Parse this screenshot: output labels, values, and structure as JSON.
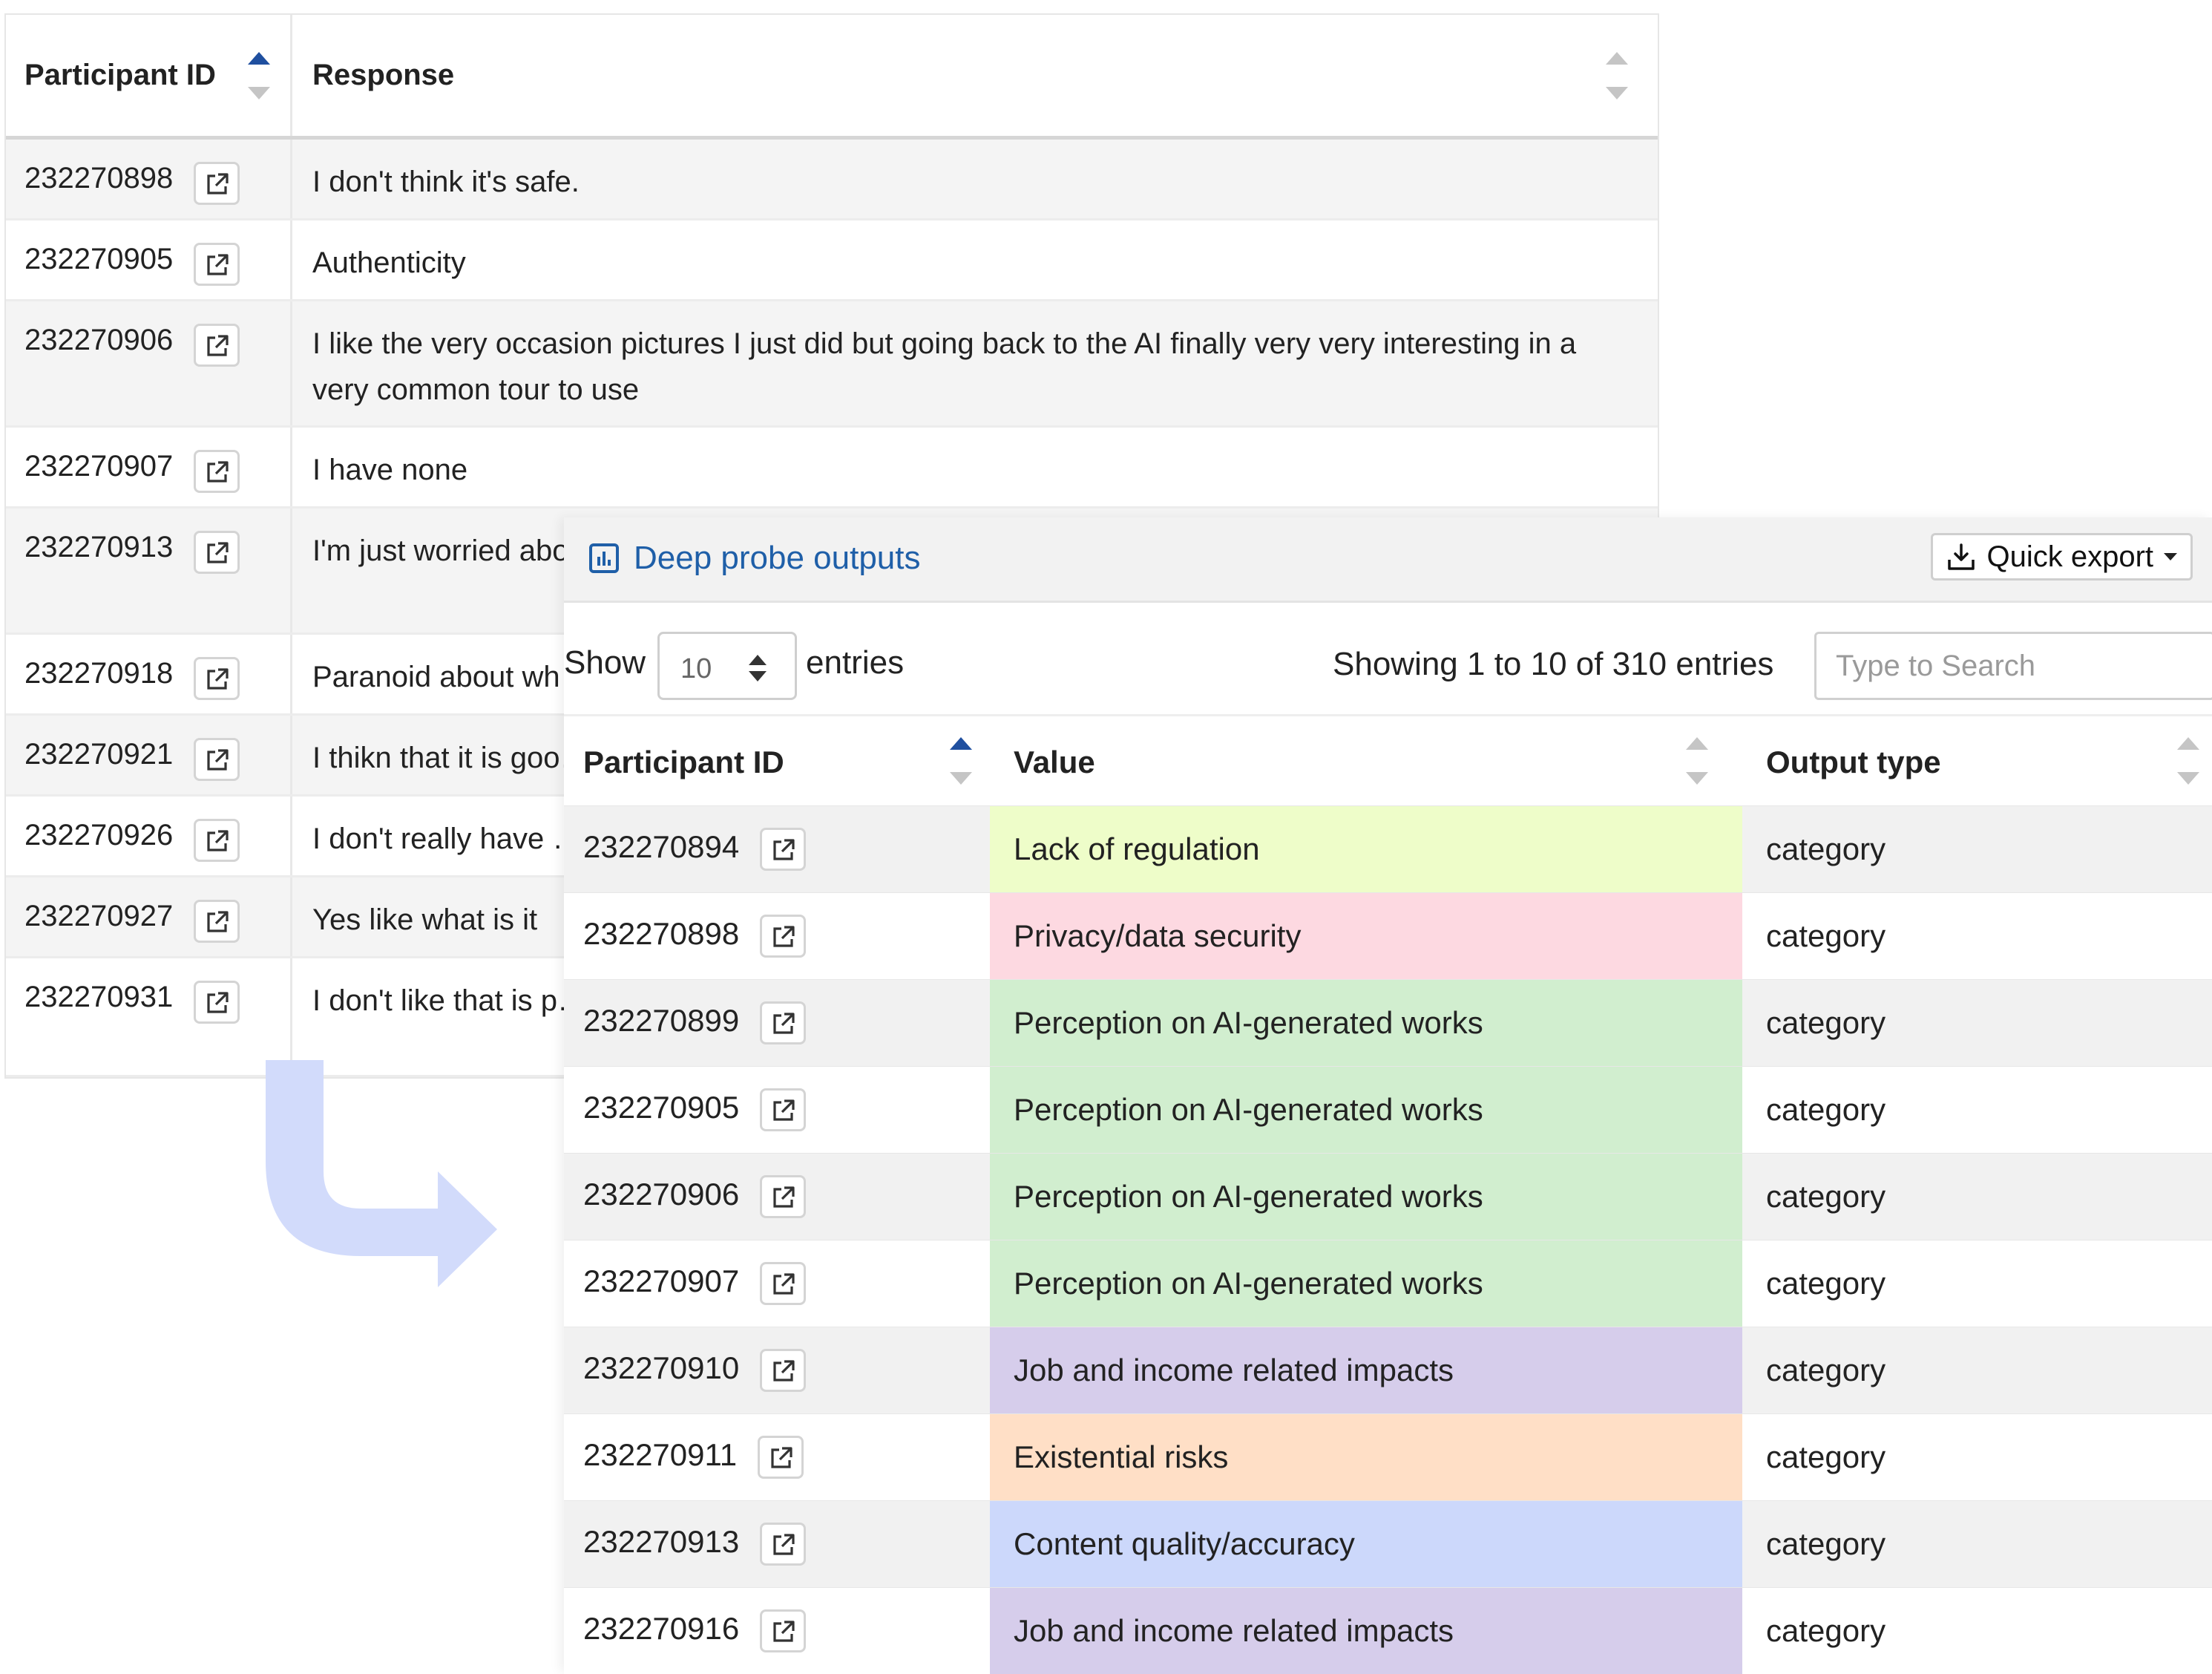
{
  "responses_table": {
    "headers": {
      "participant_id": "Participant ID",
      "response": "Response"
    },
    "rows": [
      {
        "id": "232270898",
        "response": "I don't think it's safe."
      },
      {
        "id": "232270905",
        "response": "Authenticity"
      },
      {
        "id": "232270906",
        "response": "I like the very occasion pictures I just did but going back to the AI finally very very interesting in a very common tour to use"
      },
      {
        "id": "232270907",
        "response": "I have none"
      },
      {
        "id": "232270913",
        "response": "I'm just worried abo… contact with real pe…"
      },
      {
        "id": "232270918",
        "response": "Paranoid about wh…"
      },
      {
        "id": "232270921",
        "response": "I thikn that it is goo…"
      },
      {
        "id": "232270926",
        "response": "I don't really have …"
      },
      {
        "id": "232270927",
        "response": "Yes like what is it"
      },
      {
        "id": "232270931",
        "response": "I don't like that is p… that it can cause m…"
      }
    ]
  },
  "deep_probe": {
    "title": "Deep probe outputs",
    "quick_export_label": "Quick export",
    "show_label": "Show",
    "entries_per_page": "10",
    "entries_label": "entries",
    "info": "Showing 1 to 10 of 310 entries",
    "search_placeholder": "Type to Search",
    "headers": {
      "participant_id": "Participant ID",
      "value": "Value",
      "output_type": "Output type"
    },
    "rows": [
      {
        "id": "232270894",
        "value": "Lack of regulation",
        "type": "category",
        "color": "#eefdc9"
      },
      {
        "id": "232270898",
        "value": "Privacy/data security",
        "type": "category",
        "color": "#fdd9e1"
      },
      {
        "id": "232270899",
        "value": "Perception on AI-generated works",
        "type": "category",
        "color": "#d1eecf"
      },
      {
        "id": "232270905",
        "value": "Perception on AI-generated works",
        "type": "category",
        "color": "#d1eecf"
      },
      {
        "id": "232270906",
        "value": "Perception on AI-generated works",
        "type": "category",
        "color": "#d1eecf"
      },
      {
        "id": "232270907",
        "value": "Perception on AI-generated works",
        "type": "category",
        "color": "#d1eecf"
      },
      {
        "id": "232270910",
        "value": "Job and income related impacts",
        "type": "category",
        "color": "#d6cdeb"
      },
      {
        "id": "232270911",
        "value": "Existential risks",
        "type": "category",
        "color": "#ffdfc6"
      },
      {
        "id": "232270913",
        "value": "Content quality/accuracy",
        "type": "category",
        "color": "#ccd8fb"
      },
      {
        "id": "232270916",
        "value": "Job and income related impacts",
        "type": "category",
        "color": "#d6cdeb"
      }
    ]
  },
  "colors": {
    "accent_blue": "#1f5fa8",
    "sort_active": "#1f4f9f",
    "arrow": "#d2dbfb"
  },
  "icons": {
    "external_link": "external-link-icon",
    "chart": "bar-chart-icon",
    "download": "download-icon"
  }
}
